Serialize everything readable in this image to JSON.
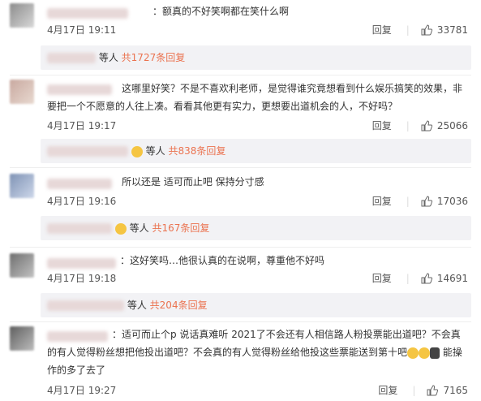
{
  "comments": [
    {
      "text": "：额真的不好笑啊都在笑什么啊",
      "date": "4月17日 19:11",
      "reply_label": "回复",
      "likes": "33781",
      "replies_prefix": "等人",
      "replies_count": "共1727条回复"
    },
    {
      "text": "这哪里好笑？不是不喜欢利老师，是觉得谁究竟想看到什么娱乐搞笑的效果，非要把一个不愿意的人往上凑。看看其他更有实力，更想要出道机会的人，不好吗？",
      "date": "4月17日 19:17",
      "reply_label": "回复",
      "likes": "25066",
      "replies_prefix": "等人",
      "replies_count": "共838条回复"
    },
    {
      "text": "所以还是 适可而止吧 保持分寸感",
      "date": "4月17日 19:16",
      "reply_label": "回复",
      "likes": "17036",
      "replies_prefix": "等人",
      "replies_count": "共167条回复"
    },
    {
      "text": "：这好笑吗…他很认真的在说啊，尊重他不好吗",
      "date": "4月17日 19:18",
      "reply_label": "回复",
      "likes": "14691",
      "replies_prefix": "等人",
      "replies_count": "共204条回复"
    },
    {
      "text": "：适可而止个p 说话真难听 2021了不会还有人相信路人粉投票能出道吧？不会真的有人觉得粉丝想把他投出道吧？不会真的有人觉得粉丝给他投这些票能送到第十吧",
      "text_tail": "能操作的多了去了",
      "date": "4月17日 19:27",
      "reply_label": "回复",
      "likes": "7165"
    }
  ]
}
